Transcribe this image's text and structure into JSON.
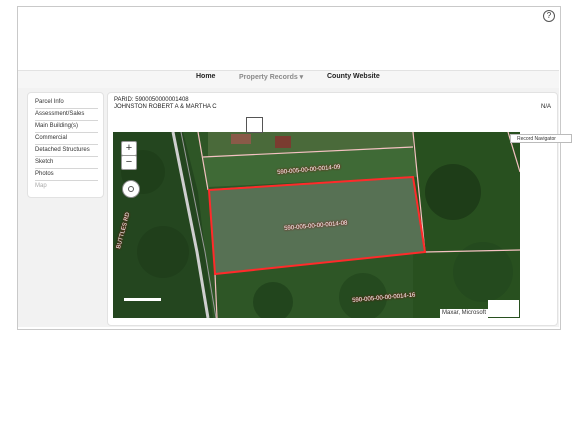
{
  "header": {
    "help_glyph": "?"
  },
  "nav": {
    "home": "Home",
    "property_records": "Property Records ▾",
    "county_website": "County Website"
  },
  "sidebar": {
    "items": [
      {
        "label": "Parcel Info"
      },
      {
        "label": "Assessment/Sales"
      },
      {
        "label": "Main Building(s)"
      },
      {
        "label": "Commercial"
      },
      {
        "label": "Detached Structures"
      },
      {
        "label": "Sketch"
      },
      {
        "label": "Photos"
      },
      {
        "label": "Map"
      }
    ]
  },
  "parcel": {
    "parid": "PARID: 5900050000001408",
    "owner": "JOHNSTON ROBERT A & MARTHA C",
    "right_value": "N/A"
  },
  "map": {
    "zoom_in": "+",
    "zoom_out": "−",
    "attribution": "Maxar, Microsoft",
    "road_label": "BUTTLES RD",
    "parcel_labels": [
      "590-005-00-00-0014-09",
      "590-005-00-00-0014-08",
      "590-005-00-00-0014-16"
    ],
    "colors": {
      "selected_parcel": "#ff2a2a",
      "parcel_lines": "#f4c2c2"
    }
  },
  "record_navigator": "Record Navigator"
}
